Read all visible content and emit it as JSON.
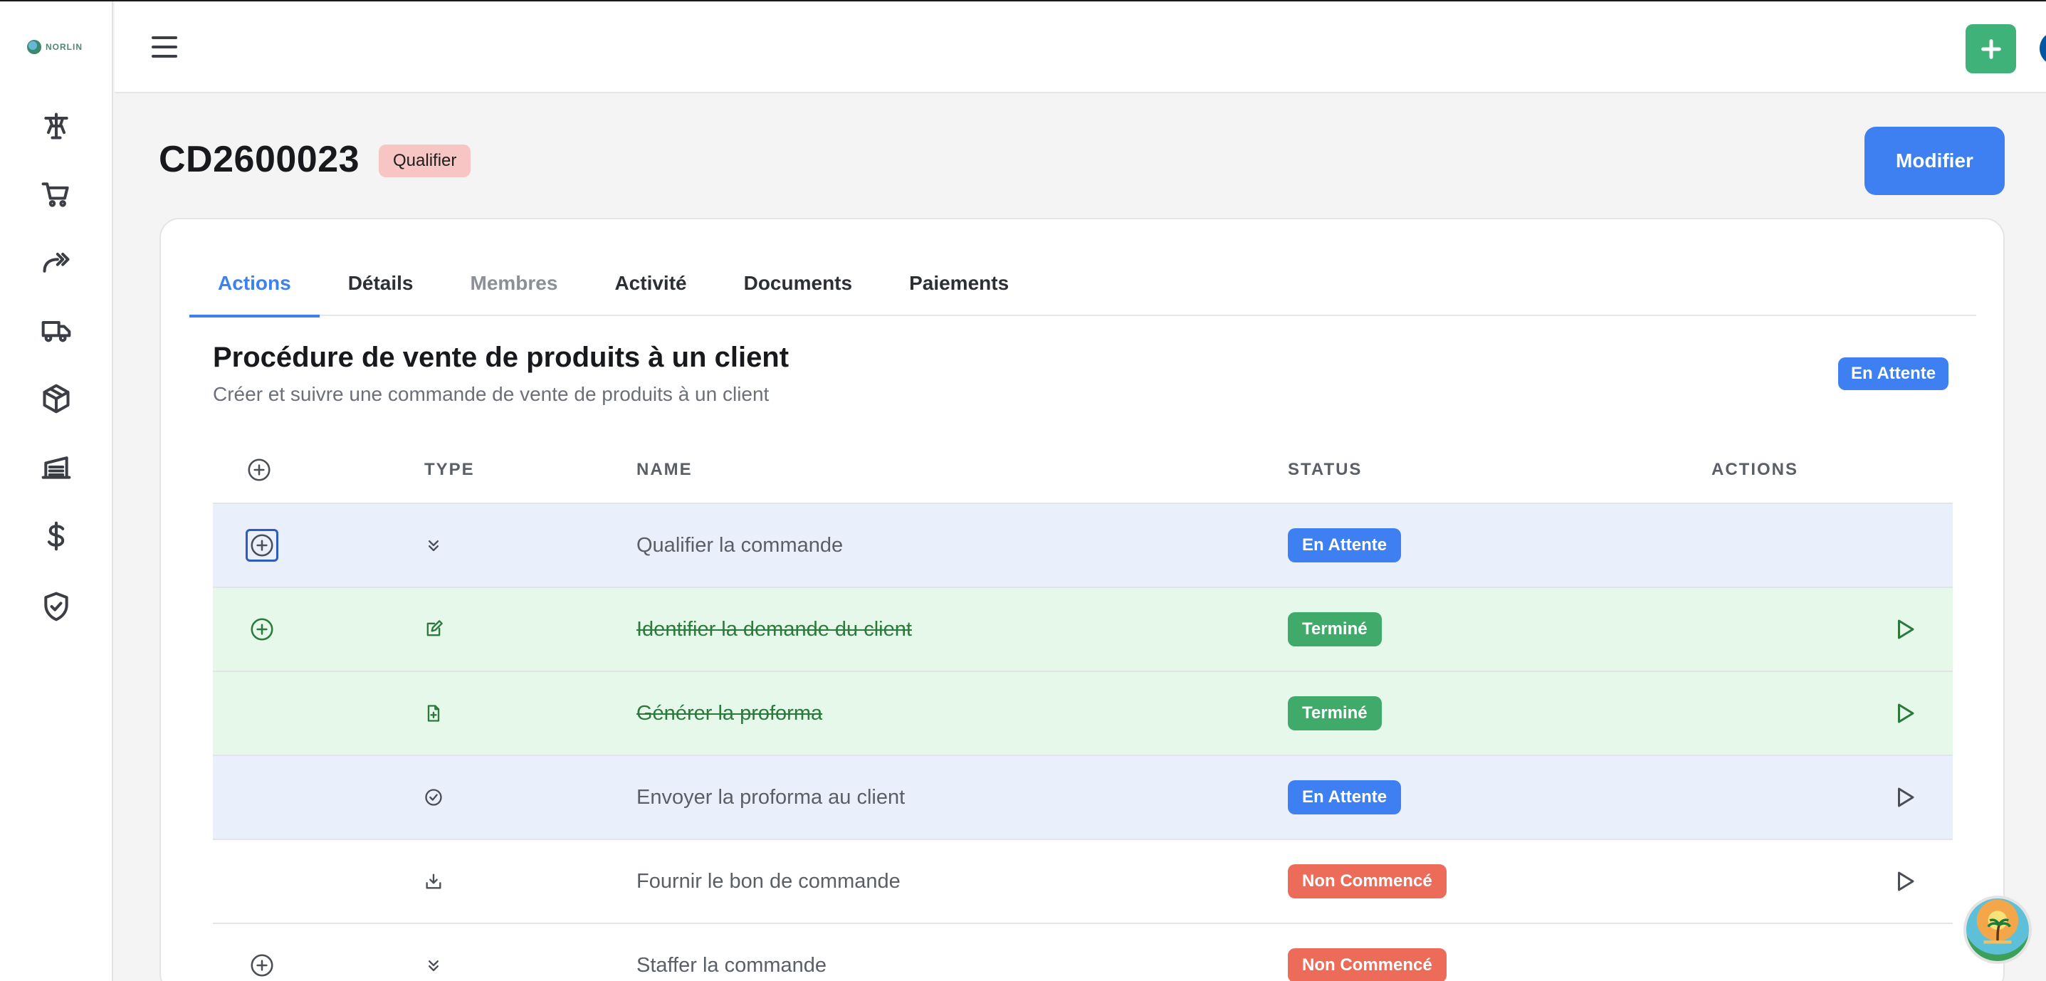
{
  "app": {
    "logo_text": "NORLIN",
    "flag": {
      "colors": [
        "#0055a4",
        "#ffffff",
        "#ef4135"
      ]
    }
  },
  "sidebar": {
    "items": [
      {
        "icon": "dashboard-icon"
      },
      {
        "icon": "cart-icon"
      },
      {
        "icon": "forward-arrows-icon"
      },
      {
        "icon": "truck-icon"
      },
      {
        "icon": "package-icon"
      },
      {
        "icon": "warehouse-icon"
      },
      {
        "icon": "dollar-icon"
      },
      {
        "icon": "shield-check-icon"
      }
    ]
  },
  "page": {
    "title": "CD2600023",
    "badge": "Qualifier",
    "modify_label": "Modifier"
  },
  "tabs": [
    {
      "label": "Actions",
      "state": "active"
    },
    {
      "label": "Détails",
      "state": "normal"
    },
    {
      "label": "Membres",
      "state": "muted"
    },
    {
      "label": "Activité",
      "state": "normal"
    },
    {
      "label": "Documents",
      "state": "normal"
    },
    {
      "label": "Paiements",
      "state": "normal"
    }
  ],
  "procedure": {
    "title": "Procédure de vente de produits à un client",
    "subtitle": "Créer et suivre une commande de vente de produits à un client",
    "status": "En Attente"
  },
  "table": {
    "headers": {
      "type": "TYPE",
      "name": "NAME",
      "status": "STATUS",
      "actions": "ACTIONS"
    },
    "rows": [
      {
        "name": "Qualifier la commande",
        "status": "En Attente",
        "status_color": "#3e7ff1",
        "type_icon": "double-chevron-down-icon",
        "expand": true,
        "done": false,
        "play": false
      },
      {
        "name": "Identifier la demande du client",
        "status": "Terminé",
        "status_color": "#3faa6a",
        "type_icon": "edit-icon",
        "expand": true,
        "done": true,
        "play": true
      },
      {
        "name": "Générer la proforma",
        "status": "Terminé",
        "status_color": "#3faa6a",
        "type_icon": "file-plus-icon",
        "expand": false,
        "done": true,
        "play": true
      },
      {
        "name": "Envoyer la proforma au client",
        "status": "En Attente",
        "status_color": "#3e7ff1",
        "type_icon": "check-circle-icon",
        "expand": false,
        "done": false,
        "play": true
      },
      {
        "name": "Fournir le bon de commande",
        "status": "Non Commencé",
        "status_color": "#ec6b59",
        "type_icon": "download-tray-icon",
        "expand": false,
        "done": false,
        "play": true
      },
      {
        "name": "Staffer la commande",
        "status": "Non Commencé",
        "status_color": "#ec6b59",
        "type_icon": "double-chevron-down-icon",
        "expand": true,
        "done": false,
        "play": false
      }
    ]
  }
}
